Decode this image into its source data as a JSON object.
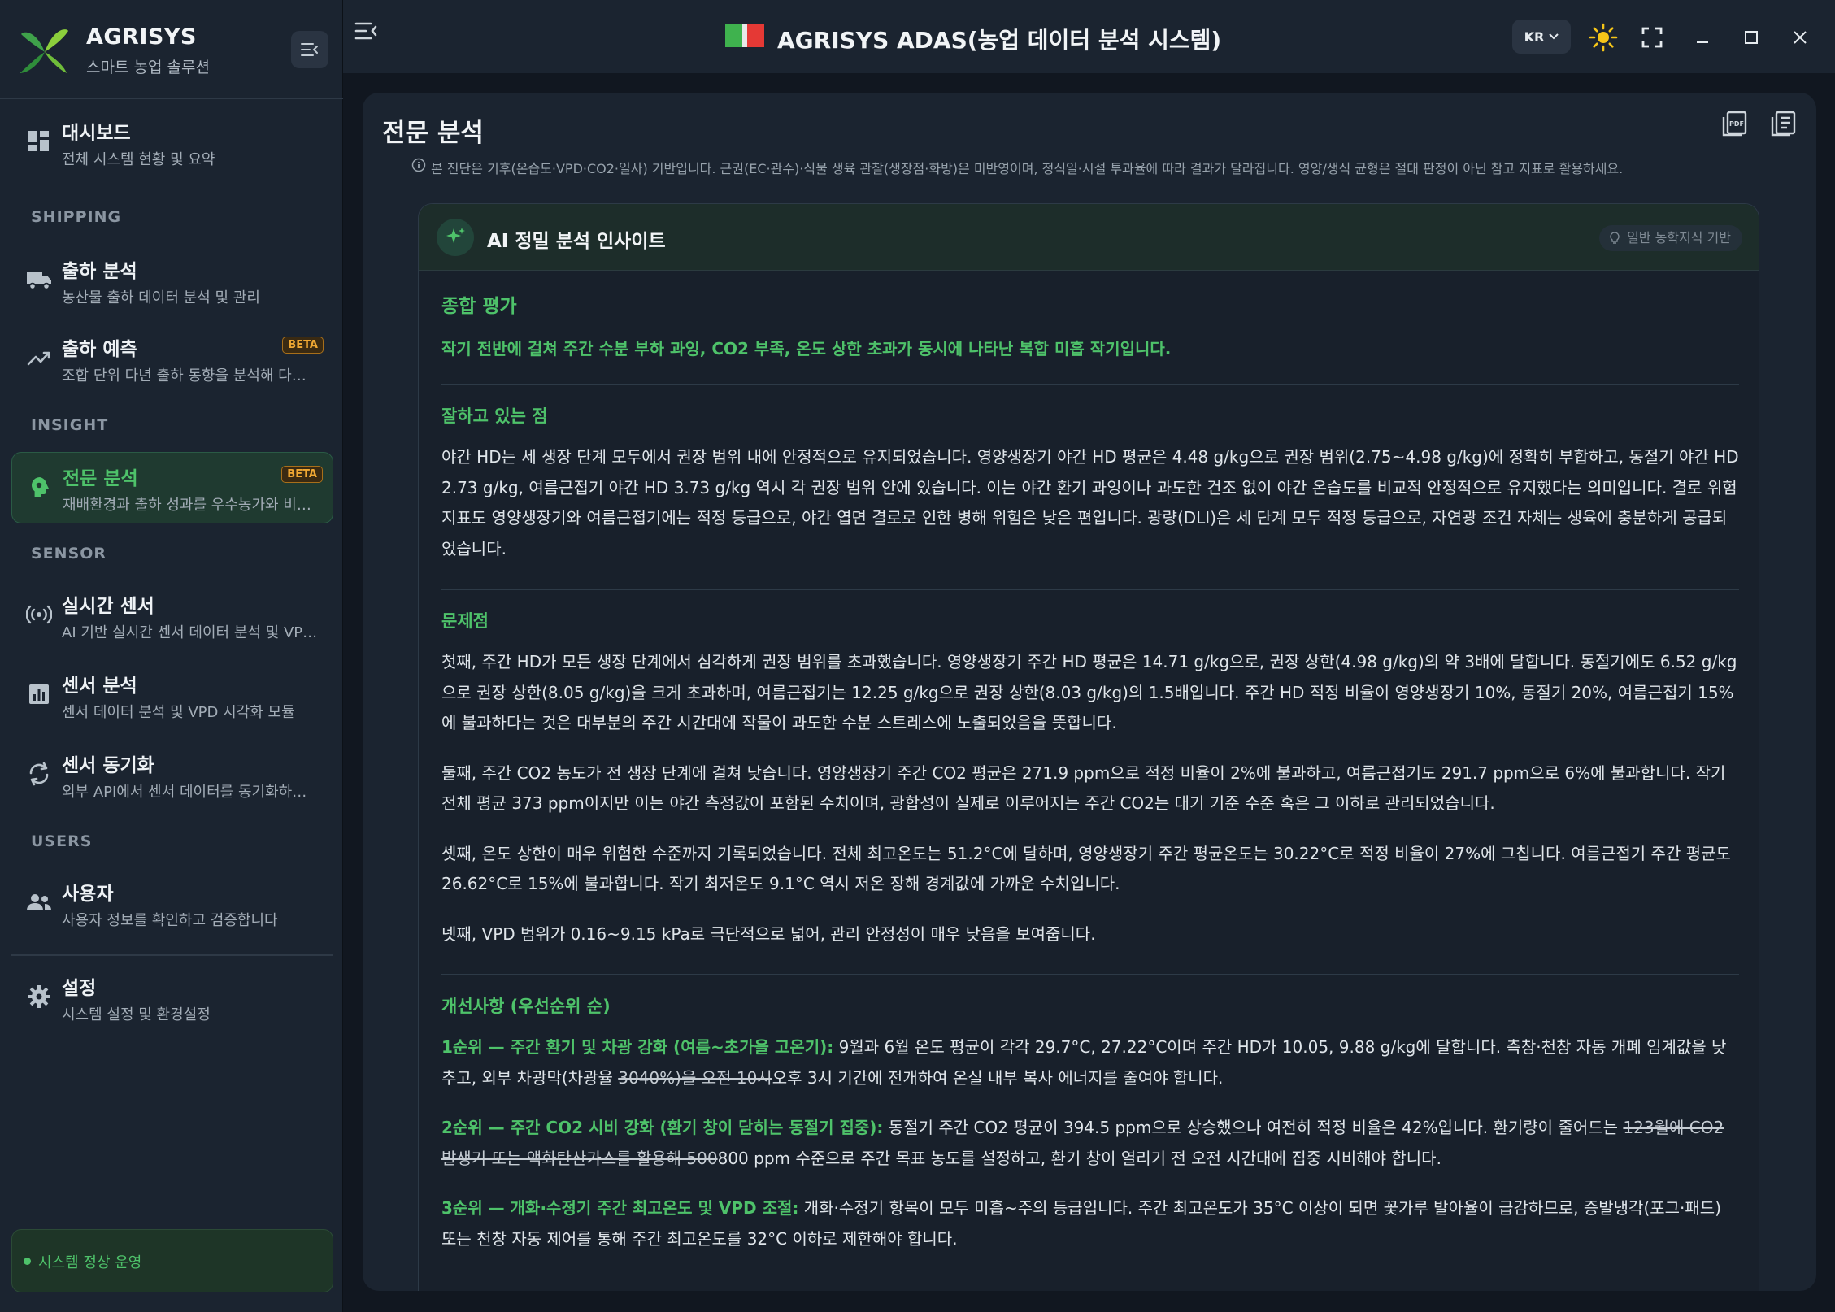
{
  "brand": {
    "name": "AGRISYS",
    "subtitle": "스마트 농업 솔루션"
  },
  "sidebar": {
    "items": [
      {
        "title": "대시보드",
        "desc": "전체 시스템 현황 및 요약",
        "icon": "dashboard-icon"
      },
      {
        "section": "SHIPPING"
      },
      {
        "title": "출하 분석",
        "desc": "농산물 출하 데이터 분석 및 관리",
        "icon": "truck-icon"
      },
      {
        "title": "출하 예측",
        "desc": "조합 단위 다년 출하 동향을 분석해 다…",
        "icon": "trending-up-icon",
        "badge": "BETA"
      },
      {
        "section": "INSIGHT"
      },
      {
        "title": "전문 분석",
        "desc": "재배환경과 출하 성과를 우수농가와 비…",
        "icon": "brain-gear-icon",
        "badge": "BETA",
        "active": true
      },
      {
        "section": "SENSOR"
      },
      {
        "title": "실시간 센서",
        "desc": "AI 기반 실시간 센서 데이터 분석 및 VP…",
        "icon": "broadcast-icon"
      },
      {
        "title": "센서 분석",
        "desc": "센서 데이터 분석 및 VPD 시각화 모듈",
        "icon": "bar-chart-icon"
      },
      {
        "title": "센서 동기화",
        "desc": "외부 API에서 센서 데이터를 동기화하…",
        "icon": "sync-icon"
      },
      {
        "section": "USERS"
      },
      {
        "title": "사용자",
        "desc": "사용자 정보를 확인하고 검증합니다",
        "icon": "users-icon"
      },
      {
        "title": "설정",
        "desc": "시스템 설정 및 환경설정",
        "icon": "gear-icon"
      }
    ],
    "status": "시스템 정상 운영"
  },
  "titlebar": {
    "title": "AGRISYS ADAS(농업 데이터 분석 시스템)",
    "lang": "KR"
  },
  "page": {
    "title": "전문 분석",
    "notice": "본 진단은 기후(온습도·VPD·CO2·일사) 기반입니다. 근권(EC·관수)·식물 생육 관찰(생장점·화방)은 미반영이며, 정식일·시설 투과율에 따라 결과가 달라집니다. 영양/생식 균형은 절대 판정이 아닌 참고 지표로 활용하세요."
  },
  "insight": {
    "title": "AI 정밀 분석 인사이트",
    "badge": "일반 농학지식 기반",
    "overall_heading": "종합 평가",
    "overall_summary": "작기 전반에 걸쳐 주간 수분 부하 과잉, CO2 부족, 온도 상한 초과가 동시에 나타난 복합 미흡 작기입니다.",
    "good_heading": "잘하고 있는 점",
    "good_text": "야간 HD는 세 생장 단계 모두에서 권장 범위 내에 안정적으로 유지되었습니다. 영양생장기 야간 HD 평균은 4.48 g/kg으로 권장 범위(2.75~4.98 g/kg)에 정확히 부합하고, 동절기 야간 HD 2.73 g/kg, 여름근접기 야간 HD 3.73 g/kg 역시 각 권장 범위 안에 있습니다. 이는 야간 환기 과잉이나 과도한 건조 없이 야간 온습도를 비교적 안정적으로 유지했다는 의미입니다. 결로 위험 지표도 영양생장기와 여름근접기에는 적정 등급으로, 야간 엽면 결로로 인한 병해 위험은 낮은 편입니다. 광량(DLI)은 세 단계 모두 적정 등급으로, 자연광 조건 자체는 생육에 충분하게 공급되었습니다.",
    "problem_heading": "문제점",
    "problems": [
      "첫째, 주간 HD가 모든 생장 단계에서 심각하게 권장 범위를 초과했습니다. 영양생장기 주간 HD 평균은 14.71 g/kg으로, 권장 상한(4.98 g/kg)의 약 3배에 달합니다. 동절기에도 6.52 g/kg으로 권장 상한(8.05 g/kg)을 크게 초과하며, 여름근접기는 12.25 g/kg으로 권장 상한(8.03 g/kg)의 1.5배입니다. 주간 HD 적정 비율이 영양생장기 10%, 동절기 20%, 여름근접기 15%에 불과하다는 것은 대부분의 주간 시간대에 작물이 과도한 수분 스트레스에 노출되었음을 뜻합니다.",
      "둘째, 주간 CO2 농도가 전 생장 단계에 걸쳐 낮습니다. 영양생장기 주간 CO2 평균은 271.9 ppm으로 적정 비율이 2%에 불과하고, 여름근접기도 291.7 ppm으로 6%에 불과합니다. 작기 전체 평균 373 ppm이지만 이는 야간 측정값이 포함된 수치이며, 광합성이 실제로 이루어지는 주간 CO2는 대기 기준 수준 혹은 그 이하로 관리되었습니다.",
      "셋째, 온도 상한이 매우 위험한 수준까지 기록되었습니다. 전체 최고온도는 51.2°C에 달하며, 영양생장기 주간 평균온도는 30.22°C로 적정 비율이 27%에 그칩니다. 여름근접기 주간 평균도 26.62°C로 15%에 불과합니다. 작기 최저온도 9.1°C 역시 저온 장해 경계값에 가까운 수치입니다.",
      "넷째, VPD 범위가 0.16~9.15 kPa로 극단적으로 넓어, 관리 안정성이 매우 낮음을 보여줍니다."
    ],
    "improve_heading": "개선사항 (우선순위 순)",
    "improvements": [
      {
        "label": "1순위 — 주간 환기 및 차광 강화 (여름~초가을 고온기):",
        "before": " 9월과 6월 온도 평균이 각각 29.7°C, 27.22°C이며 주간 HD가 10.05, 9.88 g/kg에 달합니다. 측창·천창 자동 개폐 임계값을 낮추고, 외부 차광막(차광율 ",
        "struck": "3040%)을 오전 10시",
        "after": "오후 3시 기간에 전개하여 온실 내부 복사 에너지를 줄여야 합니다."
      },
      {
        "label": "2순위 — 주간 CO2 시비 강화 (환기 창이 닫히는 동절기 집중):",
        "before": " 동절기 주간 CO2 평균이 394.5 ppm으로 상승했으나 여전히 적정 비율은 42%입니다. 환기량이 줄어드는 ",
        "struck": "123월에 CO2 발생기 또는 액화탄산가스를 활용해 500",
        "after": "800 ppm 수준으로 주간 목표 농도를 설정하고, 환기 창이 열리기 전 오전 시간대에 집중 시비해야 합니다."
      },
      {
        "label": "3순위 — 개화·수정기 주간 최고온도 및 VPD 조절:",
        "before": " 개화·수정기 항목이 모두 미흡~주의 등급입니다. 주간 최고온도가 35°C 이상이 되면 꽃가루 발아율이 급감하므로, 증발냉각(포그·패드) 또는 천창 자동 제어를 통해 주간 최고온도를 32°C 이하로 제한해야 합니다.",
        "struck": "",
        "after": ""
      }
    ]
  },
  "colors": {
    "accent": "#4ec26a",
    "beta": "#f0a833",
    "bg": "#111720",
    "panel": "#1b2430"
  }
}
